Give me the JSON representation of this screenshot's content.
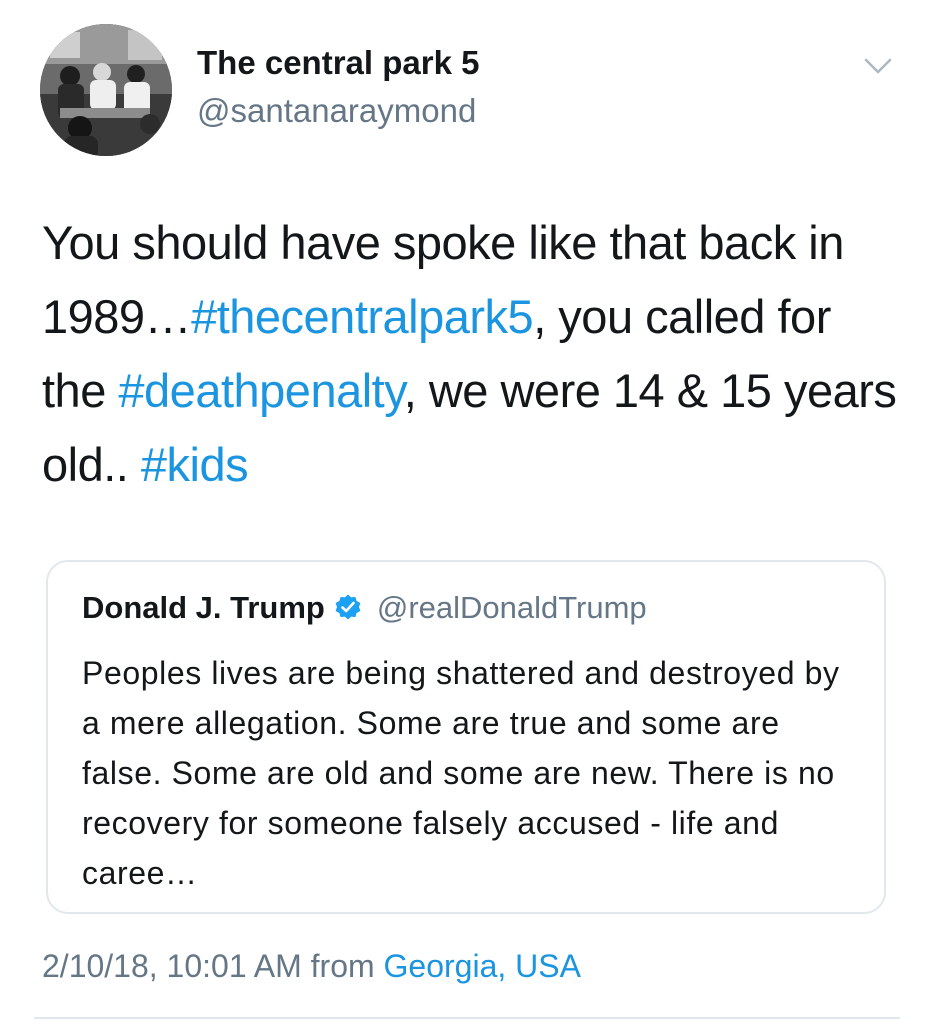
{
  "tweet": {
    "author": {
      "display_name": "The central park 5",
      "handle": "@santanaraymond",
      "avatar_icon": "group-photo-avatar"
    },
    "menu_icon": "chevron-down-icon",
    "text_parts": [
      "You should have spoke like that back in 1989…",
      "#thecentralpark5",
      ", you called for the ",
      "#deathpenalty",
      ", we were 14 & 15 years old.. ",
      "#kids"
    ],
    "timestamp": "2/10/18, 10:01 AM",
    "from_label": "from",
    "location": "Georgia, USA"
  },
  "quoted_tweet": {
    "display_name": "Donald J. Trump",
    "verified_icon": "verified-badge-icon",
    "handle": "@realDonaldTrump",
    "text": "Peoples lives are being shattered and destroyed by a mere allegation. Some are true and some are false. Some are old and some are new. There is no recovery for someone falsely accused - life and caree…"
  },
  "colors": {
    "link": "#1b95e0",
    "secondary_text": "#657786",
    "primary_text": "#14171a",
    "border": "#e1e8ed"
  }
}
